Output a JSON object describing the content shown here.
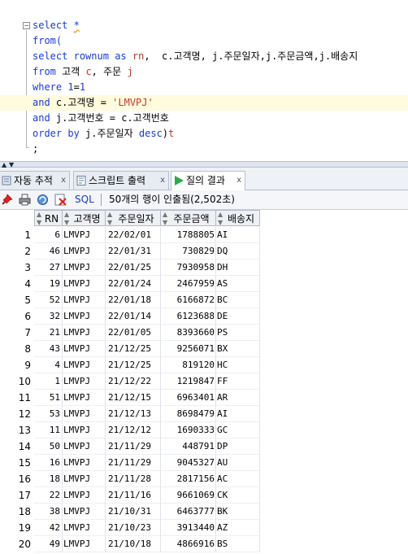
{
  "editor": {
    "lines": [
      "select *",
      "from(",
      "select rownum as rn,  c.고객명, j.주문일자,j.주문금액,j.배송지",
      "from 고객 c, 주문 j",
      "where 1=1",
      "and c.고객명 = 'LMVPJ'",
      "and j.고객번호 = c.고객번호",
      "order by j.주문일자 desc)t",
      ";"
    ]
  },
  "tabs": [
    {
      "label": "자동 추적",
      "close": "x",
      "active": false
    },
    {
      "label": "스크립트 출력",
      "close": "x",
      "active": false
    },
    {
      "label": "질의 결과",
      "close": "x",
      "active": true
    }
  ],
  "toolbar": {
    "sql_label": "SQL",
    "status": "50개의 행이 인출됨(2,502초)"
  },
  "grid": {
    "columns": [
      "RN",
      "고객명",
      "주문일자",
      "주문금액",
      "배송지"
    ],
    "rows": [
      [
        "1",
        "6",
        "LMVPJ",
        "22/02/01",
        "1788805",
        "AI"
      ],
      [
        "2",
        "46",
        "LMVPJ",
        "22/01/31",
        "730829",
        "DQ"
      ],
      [
        "3",
        "27",
        "LMVPJ",
        "22/01/25",
        "7930958",
        "DH"
      ],
      [
        "4",
        "19",
        "LMVPJ",
        "22/01/24",
        "2467959",
        "AS"
      ],
      [
        "5",
        "52",
        "LMVPJ",
        "22/01/18",
        "6166872",
        "BC"
      ],
      [
        "6",
        "32",
        "LMVPJ",
        "22/01/14",
        "6123688",
        "DE"
      ],
      [
        "7",
        "21",
        "LMVPJ",
        "22/01/05",
        "8393660",
        "PS"
      ],
      [
        "8",
        "43",
        "LMVPJ",
        "21/12/25",
        "9256071",
        "BX"
      ],
      [
        "9",
        "4",
        "LMVPJ",
        "21/12/25",
        "819120",
        "HC"
      ],
      [
        "10",
        "1",
        "LMVPJ",
        "21/12/22",
        "1219847",
        "FF"
      ],
      [
        "11",
        "51",
        "LMVPJ",
        "21/12/15",
        "6963401",
        "AR"
      ],
      [
        "12",
        "53",
        "LMVPJ",
        "21/12/13",
        "8698479",
        "AI"
      ],
      [
        "13",
        "11",
        "LMVPJ",
        "21/12/12",
        "1690333",
        "GC"
      ],
      [
        "14",
        "50",
        "LMVPJ",
        "21/11/29",
        "448791",
        "DP"
      ],
      [
        "15",
        "16",
        "LMVPJ",
        "21/11/29",
        "9045327",
        "AU"
      ],
      [
        "16",
        "18",
        "LMVPJ",
        "21/11/28",
        "2817156",
        "AC"
      ],
      [
        "17",
        "22",
        "LMVPJ",
        "21/11/16",
        "9661069",
        "CK"
      ],
      [
        "18",
        "38",
        "LMVPJ",
        "21/10/31",
        "6463777",
        "BK"
      ],
      [
        "19",
        "42",
        "LMVPJ",
        "21/10/23",
        "3913440",
        "AZ"
      ],
      [
        "20",
        "49",
        "LMVPJ",
        "21/10/18",
        "4866916",
        "BS"
      ]
    ]
  }
}
